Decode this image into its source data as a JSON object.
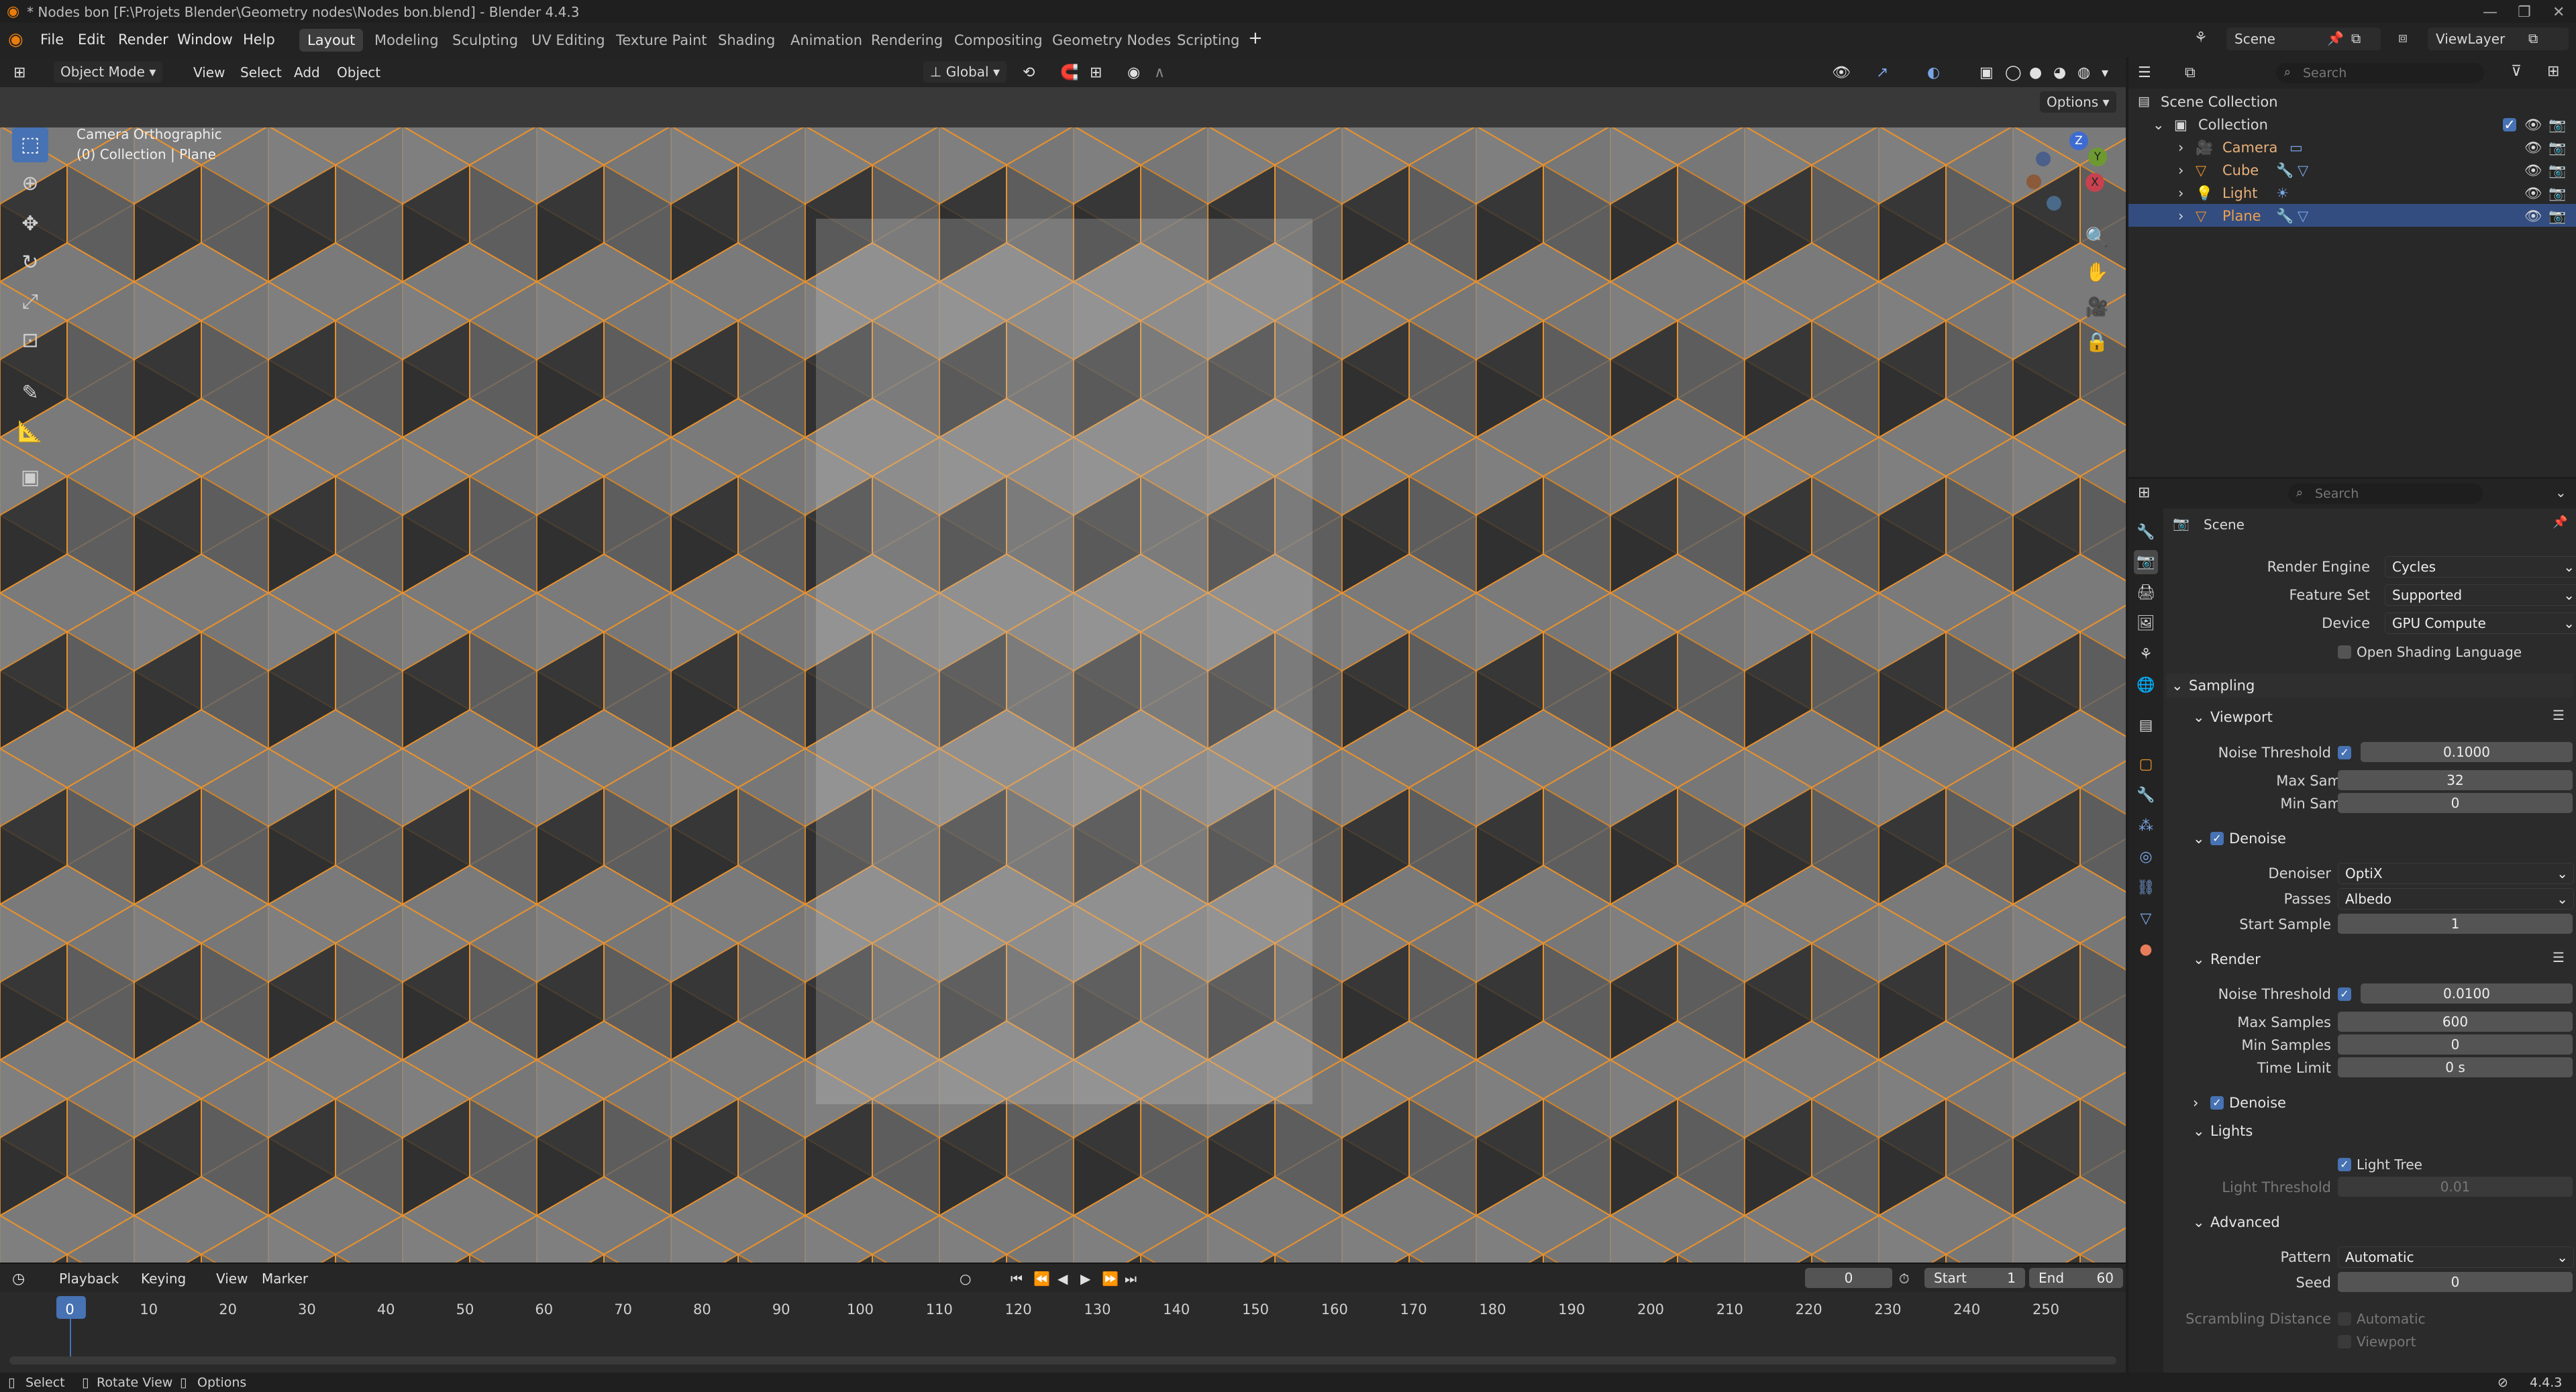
{
  "window": {
    "title": "* Nodes bon [F:\\Projets Blender\\Geometry nodes\\Nodes bon.blend] - Blender 4.4.3"
  },
  "menus": [
    "File",
    "Edit",
    "Render",
    "Window",
    "Help"
  ],
  "workspaces": [
    "Layout",
    "Modeling",
    "Sculpting",
    "UV Editing",
    "Texture Paint",
    "Shading",
    "Animation",
    "Rendering",
    "Compositing",
    "Geometry Nodes",
    "Scripting"
  ],
  "active_workspace": "Layout",
  "top_right": {
    "scene": "Scene",
    "view_layer": "ViewLayer"
  },
  "viewport": {
    "mode": "Object Mode",
    "menu": [
      "View",
      "Select",
      "Add",
      "Object"
    ],
    "transform": "Global",
    "options": "Options",
    "overlay_title": "Camera Orthographic",
    "overlay_sub": "(0) Collection | Plane",
    "gizmo": {
      "z": "Z",
      "y": "Y",
      "x": "X"
    }
  },
  "timeline": {
    "menu": [
      "Playback",
      "Keying",
      "View",
      "Marker"
    ],
    "current_frame": "0",
    "start_label": "Start",
    "start": "1",
    "end_label": "End",
    "end": "60",
    "ruler": [
      "0",
      "10",
      "20",
      "30",
      "40",
      "50",
      "60",
      "70",
      "80",
      "90",
      "100",
      "110",
      "120",
      "130",
      "140",
      "150",
      "160",
      "170",
      "180",
      "190",
      "200",
      "210",
      "220",
      "230",
      "240",
      "250"
    ]
  },
  "outliner": {
    "search_placeholder": "Search",
    "root": "Scene Collection",
    "collection": "Collection",
    "items": [
      "Camera",
      "Cube",
      "Light",
      "Plane"
    ],
    "selected": "Plane"
  },
  "properties": {
    "search_placeholder": "Search",
    "context": "Scene",
    "render_engine_label": "Render Engine",
    "render_engine": "Cycles",
    "feature_set_label": "Feature Set",
    "feature_set": "Supported",
    "device_label": "Device",
    "device": "GPU Compute",
    "osl_label": "Open Shading Language",
    "sampling": "Sampling",
    "viewport": "Viewport",
    "noise_threshold_label": "Noise Threshold",
    "vp_noise_threshold": "0.1000",
    "max_samples_label": "Max Samples",
    "vp_max_samples": "32",
    "min_samples_label": "Min Samples",
    "vp_min_samples": "0",
    "denoise": "Denoise",
    "denoiser_label": "Denoiser",
    "denoiser": "OptiX",
    "passes_label": "Passes",
    "passes": "Albedo",
    "start_sample_label": "Start Sample",
    "start_sample": "1",
    "render": "Render",
    "r_noise_threshold": "0.0100",
    "r_max_samples": "600",
    "r_min_samples": "0",
    "time_limit_label": "Time Limit",
    "time_limit": "0 s",
    "lights": "Lights",
    "light_tree": "Light Tree",
    "light_threshold_label": "Light Threshold",
    "light_threshold": "0.01",
    "advanced": "Advanced",
    "pattern_label": "Pattern",
    "pattern": "Automatic",
    "seed_label": "Seed",
    "seed": "0",
    "scrambling_label": "Scrambling Distance",
    "scr_auto": "Automatic",
    "scr_viewport": "Viewport"
  },
  "status": {
    "select": "Select",
    "rotate": "Rotate View",
    "options": "Options",
    "version": "4.4.3"
  },
  "colors": {
    "accent": "#4772b3",
    "selection_outline": "#e8912d",
    "background": "#393939"
  }
}
